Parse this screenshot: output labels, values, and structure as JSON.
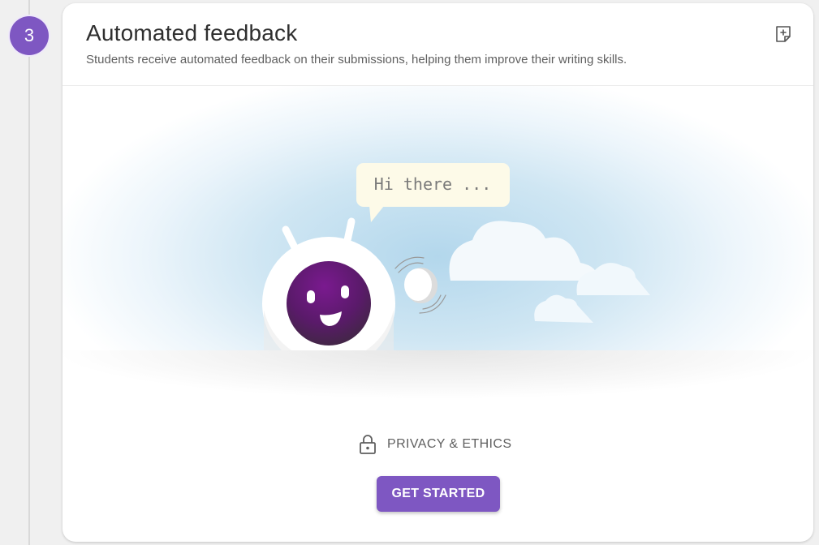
{
  "step": {
    "number": "3"
  },
  "card": {
    "title": "Automated feedback",
    "description": "Students receive automated feedback on their submissions, helping them improve their writing skills."
  },
  "illustration": {
    "speech_bubble": "Hi there ..."
  },
  "privacy": {
    "label": "PRIVACY & ETHICS"
  },
  "actions": {
    "get_started_label": "GET STARTED"
  },
  "colors": {
    "accent": "#7e57c2",
    "robot_face": "#6b1a7e",
    "speech_bubble_bg": "#fdfae8"
  },
  "icons": {
    "add_note": "add-note-icon",
    "lock": "lock-icon"
  }
}
